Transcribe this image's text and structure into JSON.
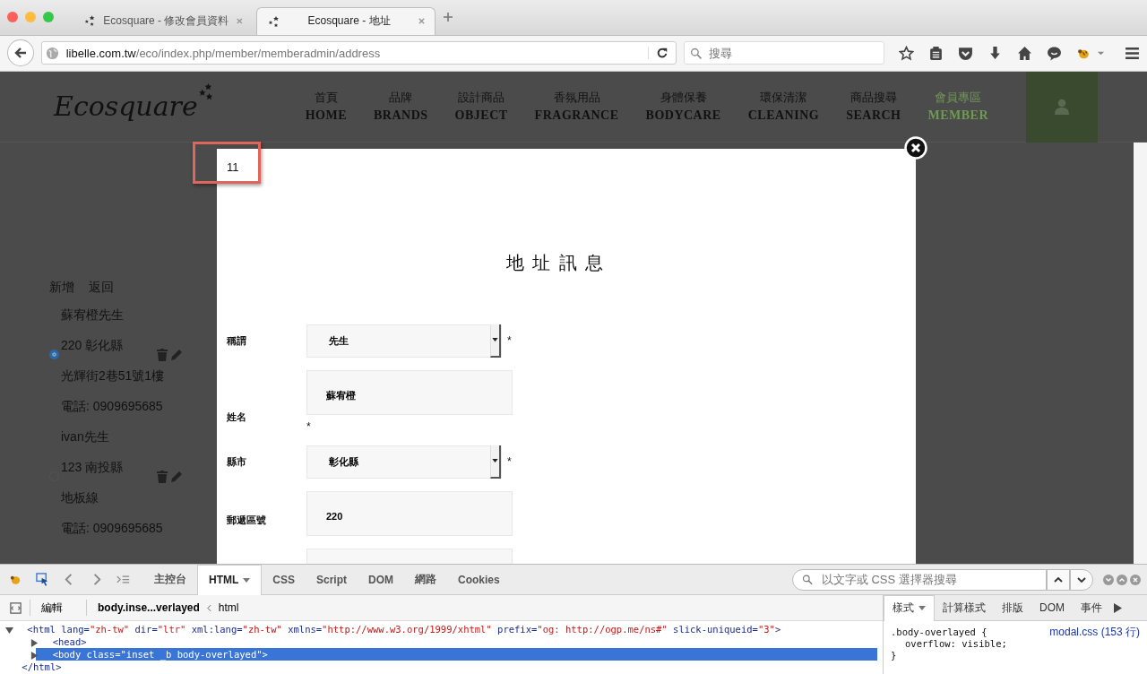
{
  "browser": {
    "tabs": [
      {
        "title": "Ecosquare - 修改會員資料",
        "selected": false
      },
      {
        "title": "Ecosquare - 地址",
        "selected": true
      }
    ],
    "url_host": "libelle.com.tw",
    "url_path": "/eco/index.php/member/memberadmin/address",
    "search": {
      "placeholder": "搜尋"
    }
  },
  "site": {
    "logo": "Ecosquare",
    "nav": [
      {
        "zh": "首頁",
        "en": "HOME",
        "selected": false
      },
      {
        "zh": "品牌",
        "en": "BRANDS",
        "selected": false
      },
      {
        "zh": "設計商品",
        "en": "OBJECT",
        "selected": false
      },
      {
        "zh": "香氛用品",
        "en": "FRAGRANCE",
        "selected": false
      },
      {
        "zh": "身體保養",
        "en": "BODYCARE",
        "selected": false
      },
      {
        "zh": "環保清潔",
        "en": "CLEANING",
        "selected": false
      },
      {
        "zh": "商品搜尋",
        "en": "SEARCH",
        "selected": false
      },
      {
        "zh": "會員專區",
        "en": "MEMBER",
        "selected": true
      }
    ]
  },
  "sidebar": {
    "actions": [
      "新增",
      "返回"
    ],
    "addresses": [
      {
        "selected": true,
        "lines": [
          "蘇宥橙先生",
          "220 彰化縣",
          "光輝街2巷51號1樓",
          "電話: 0909695685"
        ]
      },
      {
        "selected": false,
        "lines": [
          "ivan先生",
          "123 南投縣",
          "地板線",
          "電話: 0909695685"
        ]
      }
    ]
  },
  "annotation": "11",
  "modal": {
    "title": "地 址 訊 息",
    "fields": [
      {
        "label": "稱謂",
        "kind": "select",
        "value": "先生",
        "mark": "*"
      },
      {
        "label": "姓名",
        "kind": "text",
        "value": "蘇宥橙",
        "mark": "*"
      },
      {
        "label": "縣市",
        "kind": "select",
        "value": "彰化縣",
        "mark": "*"
      },
      {
        "label": "郵遞區號",
        "kind": "text",
        "value": "220"
      },
      {
        "kind": "text"
      }
    ]
  },
  "devtools": {
    "tabs": [
      {
        "label": "主控台",
        "selected": false
      },
      {
        "label": "HTML",
        "selected": true
      },
      {
        "label": "CSS",
        "selected": false
      },
      {
        "label": "Script",
        "selected": false
      },
      {
        "label": "DOM",
        "selected": false
      },
      {
        "label": "網路",
        "selected": false
      },
      {
        "label": "Cookies",
        "selected": false
      }
    ],
    "search": {
      "placeholder": "以文字或 CSS 選擇器搜尋"
    },
    "edit": "編輯",
    "breadcrumbs": [
      "body.inse...verlayed",
      "html"
    ],
    "html": [
      {
        "kind": "element",
        "text": "<html lang=\"zh-tw\" dir=\"ltr\" xml:lang=\"zh-tw\" xmlns=\"http://www.w3.org/1999/xhtml\" prefix=\"og: http://ogp.me/ns#\" slick-uniqueid=\"3\">",
        "expanded": true,
        "selected": false,
        "children": [
          {
            "kind": "element",
            "text": "<head>",
            "expanded": false,
            "selected": false
          },
          {
            "kind": "element",
            "text": "<body class=\"inset _b body-overlayed\">",
            "expanded": false,
            "selected": true
          }
        ]
      },
      {
        "kind": "close",
        "text": "</html>",
        "selected": false
      }
    ],
    "side_tabs": [
      {
        "label": "樣式",
        "selected": true
      },
      {
        "label": "計算樣式",
        "selected": false
      },
      {
        "label": "排版",
        "selected": false
      },
      {
        "label": "DOM",
        "selected": false
      },
      {
        "label": "事件",
        "selected": false
      }
    ],
    "css_rule": {
      "selector": ".body-overlayed {",
      "declaration": "overflow: visible;",
      "close": "}",
      "source": "modal.css (153 行)"
    }
  }
}
